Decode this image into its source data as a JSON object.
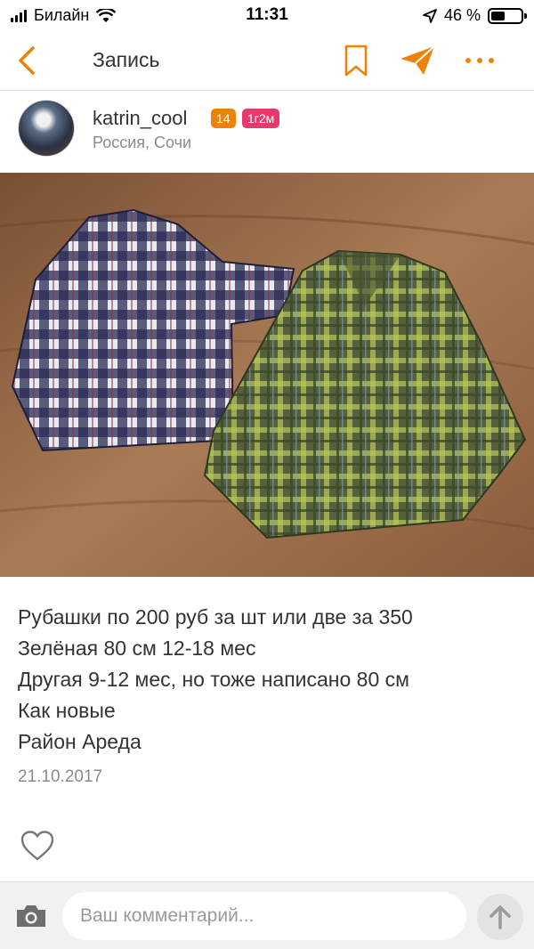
{
  "status_bar": {
    "carrier": "Билайн",
    "time": "11:31",
    "battery_percent": "46 %",
    "battery_level": 0.46
  },
  "nav": {
    "title": "Запись",
    "back_icon": "chevron-left-icon",
    "bookmark_icon": "bookmark-icon",
    "share_icon": "paper-plane-icon",
    "more_icon": "more-dots-icon",
    "accent_color": "#ee8208"
  },
  "author": {
    "name": "katrin_cool",
    "age_badge": "14",
    "time_badge": "1г2м",
    "location": "Россия, Сочи"
  },
  "post": {
    "lines": [
      "Рубашки по 200 руб за шт или две за 350",
      "Зелёная 80 см 12-18 мес",
      "Другая 9-12 мес, но тоже написано 80 см",
      "Как новые",
      "Район Ареда"
    ],
    "date": "21.10.2017"
  },
  "actions": {
    "like_icon": "heart-outline-icon"
  },
  "comment": {
    "placeholder": "Ваш комментарий...",
    "camera_icon": "camera-icon",
    "send_icon": "arrow-up-icon"
  }
}
